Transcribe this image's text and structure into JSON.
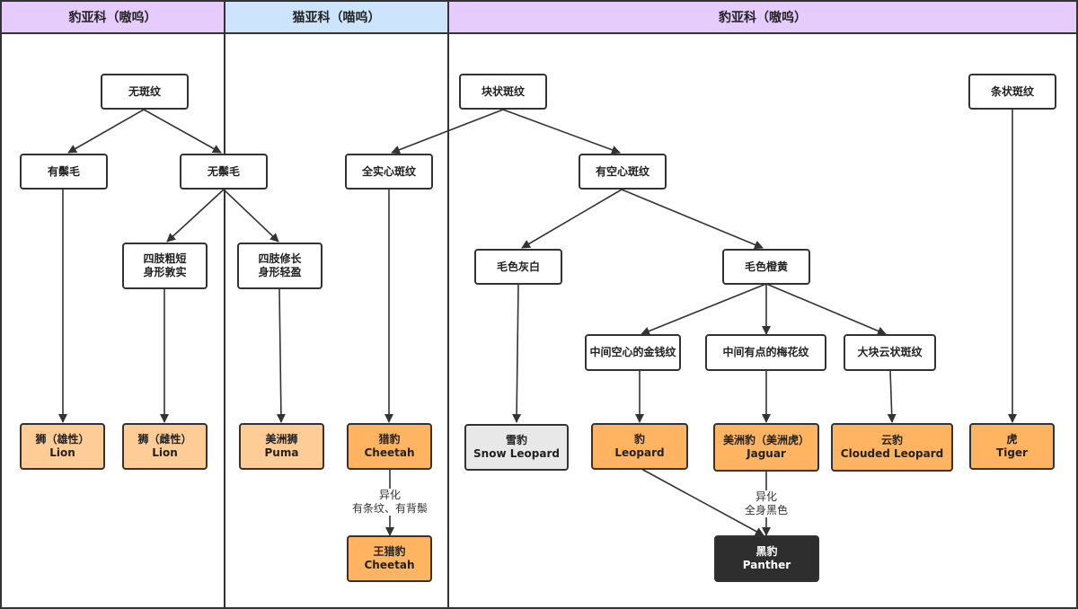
{
  "lanes": [
    {
      "id": "lane1",
      "title": "豹亚科（嗷呜）",
      "color": "#e6ccfd"
    },
    {
      "id": "lane2",
      "title": "猫亚科（喵呜）",
      "color": "#cce5fd"
    },
    {
      "id": "lane3",
      "title": "豹亚科（嗷呜）",
      "color": "#e6ccfd"
    }
  ],
  "nodes": {
    "no_spots": {
      "line1": "无斑纹"
    },
    "has_mane": {
      "line1": "有鬃毛"
    },
    "no_mane": {
      "line1": "无鬃毛"
    },
    "short_limbs": {
      "line1": "四肢粗短",
      "line2": "身形敦实"
    },
    "long_limbs": {
      "line1": "四肢修长",
      "line2": "身形轻盈"
    },
    "solid_spots": {
      "line1": "全实心斑纹"
    },
    "block_spots": {
      "line1": "块状斑纹"
    },
    "hollow_spots": {
      "line1": "有空心斑纹"
    },
    "gray_white": {
      "line1": "毛色灰白"
    },
    "orange_yellow": {
      "line1": "毛色橙黄"
    },
    "rosette_hollow": {
      "line1": "中间空心的金钱纹"
    },
    "rosette_dot": {
      "line1": "中间有点的梅花纹"
    },
    "cloud_spots": {
      "line1": "大块云状斑纹"
    },
    "stripes": {
      "line1": "条状斑纹"
    },
    "lion_male": {
      "line1": "狮（雄性）",
      "line2": "Lion"
    },
    "lion_female": {
      "line1": "狮（雌性）",
      "line2": "Lion"
    },
    "puma": {
      "line1": "美洲狮",
      "line2": "Puma"
    },
    "cheetah": {
      "line1": "猎豹",
      "line2": "Cheetah"
    },
    "king_cheetah": {
      "line1": "王猎豹",
      "line2": "Cheetah"
    },
    "snow_leopard": {
      "line1": "雪豹",
      "line2": "Snow Leopard"
    },
    "leopard": {
      "line1": "豹",
      "line2": "Leopard"
    },
    "jaguar": {
      "line1": "美洲豹（美洲虎）",
      "line2": "Jaguar"
    },
    "clouded_leopard": {
      "line1": "云豹",
      "line2": "Clouded Leopard"
    },
    "tiger": {
      "line1": "虎",
      "line2": "Tiger"
    },
    "panther": {
      "line1": "黑豹",
      "line2": "Panther"
    }
  },
  "edge_labels": {
    "cheetah_mutation": {
      "line1": "异化",
      "line2": "有条纹、有背鬃"
    },
    "jaguar_mutation": {
      "line1": "异化",
      "line2": "全身黑色"
    }
  },
  "colors": {
    "line": "#333333",
    "node_light_orange": "#fecc96",
    "node_orange": "#feb461",
    "node_gray": "#e8e8e8",
    "node_black": "#2e2e2e"
  }
}
